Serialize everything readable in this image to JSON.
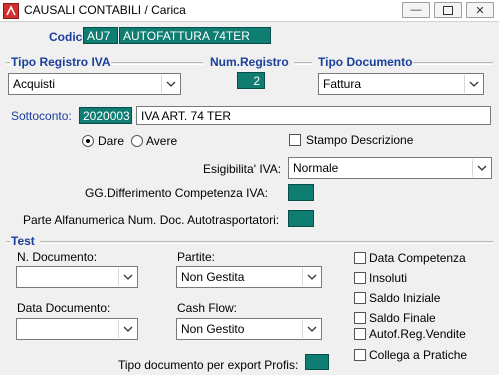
{
  "window": {
    "title": "CAUSALI CONTABILI / Carica"
  },
  "codice": {
    "label": "Codice:",
    "code": "AU7",
    "description": "AUTOFATTURA 74TER"
  },
  "tipo_registro": {
    "label": "Tipo Registro IVA",
    "value": "Acquisti"
  },
  "num_registro": {
    "label": "Num.Registro",
    "value": "2"
  },
  "tipo_documento": {
    "label": "Tipo Documento",
    "value": "Fattura"
  },
  "sottoconto": {
    "label": "Sottoconto:",
    "code": "2020003",
    "description": "IVA ART. 74 TER"
  },
  "dare_avere": {
    "dare_label": "Dare",
    "avere_label": "Avere",
    "selected": "Dare"
  },
  "stampo_descrizione": {
    "label": "Stampo Descrizione",
    "checked": false
  },
  "esigibilita": {
    "label": "Esigibilita' IVA:",
    "value": "Normale"
  },
  "gg_differimento": {
    "label": "GG.Differimento Competenza IVA:"
  },
  "parte_alfanumerica": {
    "label": "Parte Alfanumerica Num. Doc. Autotrasportatori:"
  },
  "test": {
    "label": "Test"
  },
  "n_documento": {
    "label": "N. Documento:",
    "value": ""
  },
  "partite": {
    "label": "Partite:",
    "value": "Non Gestita"
  },
  "data_documento": {
    "label": "Data Documento:",
    "value": ""
  },
  "cash_flow": {
    "label": "Cash Flow:",
    "value": "Non Gestito"
  },
  "tipo_export": {
    "label": "Tipo documento per export Profis:"
  },
  "checkboxes": [
    {
      "label": "Data Competenza",
      "checked": false
    },
    {
      "label": "Insoluti",
      "checked": false
    },
    {
      "label": "Saldo Iniziale",
      "checked": false
    },
    {
      "label": "Saldo Finale",
      "checked": false
    },
    {
      "label": "Autof.Reg.Vendite",
      "checked": false
    },
    {
      "label": "Collega a Pratiche",
      "checked": false
    }
  ],
  "colors": {
    "accent": "#0f7d72",
    "label_blue": "#1a3f9c"
  }
}
